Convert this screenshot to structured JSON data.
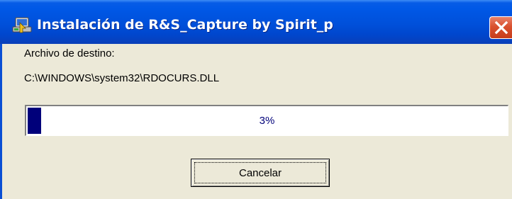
{
  "window": {
    "title": "Instalación de R&S_Capture by Spirit_p",
    "icon": "installer-icon",
    "close_icon": "close-icon"
  },
  "destination": {
    "label": "Archivo de destino:",
    "path": "C:\\WINDOWS\\system32\\RDOCURS.DLL"
  },
  "progress": {
    "value": 0.03,
    "text": "3%"
  },
  "buttons": {
    "cancel_label": "Cancelar"
  },
  "colors": {
    "titlebar": "#0054e3",
    "client_bg": "#ece9d8",
    "progress_fill": "#00007a",
    "progress_text": "#00007a",
    "close_button": "#d9502f"
  }
}
